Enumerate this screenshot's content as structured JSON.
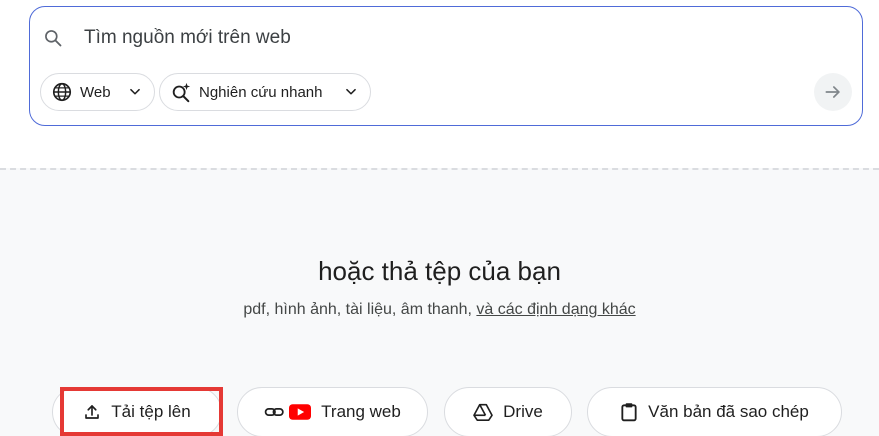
{
  "search": {
    "placeholder": "Tìm nguồn mới trên web",
    "value": "",
    "icon": "search-icon"
  },
  "chips": {
    "web_label": "Web",
    "research_label": "Nghiên cứu nhanh"
  },
  "dropzone": {
    "title": "hoặc thả tệp của bạn",
    "subtitle_text": "pdf, hình ảnh, tài liệu, âm thanh, ",
    "subtitle_link": "và các định dạng khác"
  },
  "sources": {
    "upload_label": "Tải tệp lên",
    "website_label": "Trang web",
    "drive_label": "Drive",
    "paste_label": "Văn bản đã sao chép"
  },
  "colors": {
    "accent_border": "#4f6bd8",
    "highlight": "#e53935",
    "youtube_red": "#ff0000"
  }
}
